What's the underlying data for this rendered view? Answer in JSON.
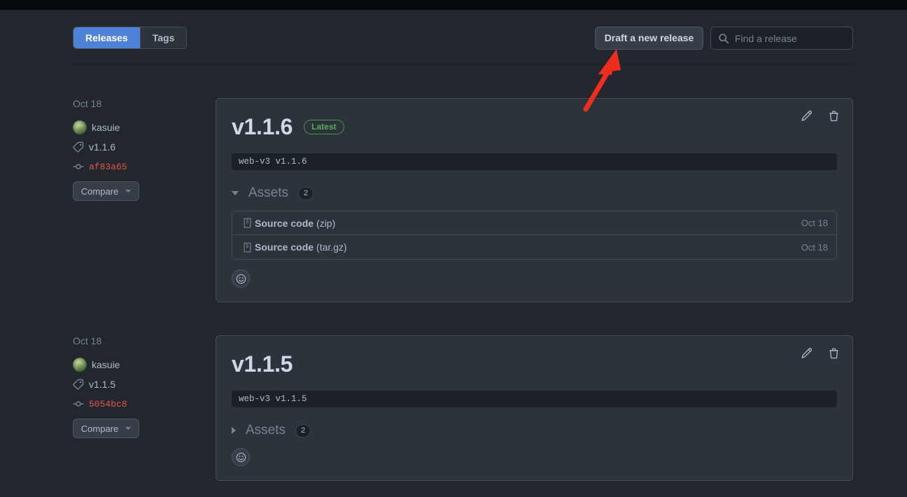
{
  "tabs": [
    {
      "label": "Releases",
      "active": true
    },
    {
      "label": "Tags",
      "active": false
    }
  ],
  "toolbar": {
    "draft_button_label": "Draft a new release",
    "search_placeholder": "Find a release",
    "search_value": "",
    "search_icon": "search-icon"
  },
  "annotation": {
    "type": "arrow",
    "color": "#ef2d1f",
    "points_to": "Draft a new release"
  },
  "colors": {
    "page_background": "#22272e",
    "card_background": "#2d333b",
    "accent_blue": "#4e82d8",
    "link_blue": "#539bf5",
    "latest_green": "#57ab5a",
    "commit_red": "#e5534b",
    "muted_text": "#768390",
    "border": "#444c56",
    "annotation_red": "#ef2d1f"
  },
  "releases": [
    {
      "meta": {
        "date": "Oct 18",
        "author": "kasuie",
        "author_avatar": "avatar",
        "tag": "v1.1.6",
        "tag_icon": "tag-icon",
        "commit": "af83a65",
        "commit_icon": "commit-icon",
        "compare_label": "Compare"
      },
      "title": "v1.1.6",
      "badge": "Latest",
      "has_badge": true,
      "body_code": "web-v3 v1.1.6",
      "edit_icon": "pencil-icon",
      "delete_icon": "trash-icon",
      "assets": {
        "label": "Assets",
        "count": "2",
        "expanded": true,
        "items": [
          {
            "name": "Source code",
            "format": "(zip)",
            "date": "Oct 18",
            "icon": "file-zip-icon"
          },
          {
            "name": "Source code",
            "format": "(tar.gz)",
            "date": "Oct 18",
            "icon": "file-zip-icon"
          }
        ]
      },
      "reaction_icon": "smiley-icon"
    },
    {
      "meta": {
        "date": "Oct 18",
        "author": "kasuie",
        "author_avatar": "avatar",
        "tag": "v1.1.5",
        "tag_icon": "tag-icon",
        "commit": "5054bc8",
        "commit_icon": "commit-icon",
        "compare_label": "Compare"
      },
      "title": "v1.1.5",
      "badge": "",
      "has_badge": false,
      "body_code": "web-v3 v1.1.5",
      "edit_icon": "pencil-icon",
      "delete_icon": "trash-icon",
      "assets": {
        "label": "Assets",
        "count": "2",
        "expanded": false,
        "items": []
      },
      "reaction_icon": "smiley-icon"
    }
  ]
}
